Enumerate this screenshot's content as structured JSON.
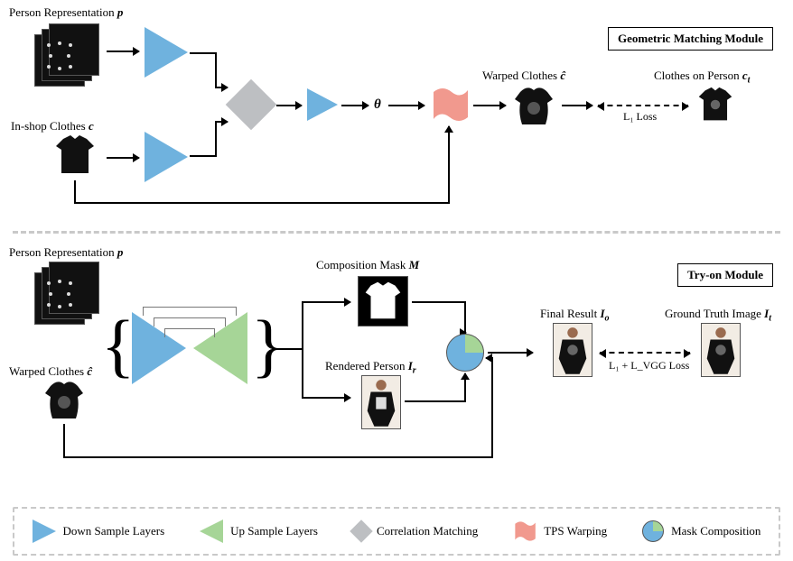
{
  "modules": {
    "gmm_title": "Geometric Matching Module",
    "tom_title": "Try-on Module"
  },
  "labels": {
    "person_rep": "Person Representation ",
    "person_rep_sym": "p",
    "inshop_clothes": "In-shop Clothes ",
    "inshop_clothes_sym": "c",
    "theta": "θ",
    "warped_clothes": "Warped Clothes ",
    "warped_clothes_sym": "ĉ",
    "clothes_on_person": "Clothes on Person ",
    "clothes_on_person_sym": "c",
    "clothes_on_person_sub": "t",
    "l1_loss": "L₁ Loss",
    "comp_mask": "Composition Mask ",
    "comp_mask_sym": "M",
    "rendered_person": "Rendered Person ",
    "rendered_person_sym": "I",
    "rendered_person_sub": "r",
    "final_result": "Final Result ",
    "final_result_sym": "I",
    "final_result_sub": "o",
    "ground_truth": "Ground Truth Image ",
    "ground_truth_sym": "I",
    "ground_truth_sub": "t",
    "l1_vgg_loss": "L₁ + L_VGG Loss",
    "warped_clothes2": "Warped Clothes ",
    "warped_clothes2_sym": "ĉ"
  },
  "legend": {
    "down": "Down Sample Layers",
    "up": "Up Sample Layers",
    "corr": "Correlation Matching",
    "tps": "TPS Warping",
    "mask": "Mask Composition"
  }
}
